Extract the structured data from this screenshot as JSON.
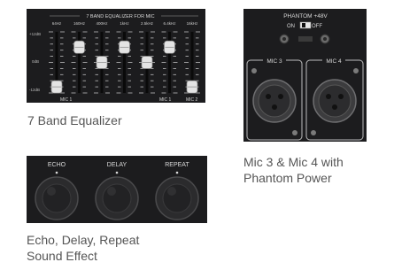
{
  "equalizer": {
    "title": "7 BAND EQUALIZER FOR MIC",
    "freqs": [
      "64Hz",
      "160Hz",
      "400Hz",
      "1kHz",
      "2.5kHz",
      "6.4kHz",
      "16kHz"
    ],
    "scale": {
      "top": "+12dB",
      "mid": "0dB",
      "bottom": "-12dB"
    },
    "bottom_labels": [
      "MIC 1",
      "MIC 2"
    ],
    "bottom_labels_right": [
      "MIC 1",
      "MIC 2"
    ],
    "slider_levels": [
      0.1,
      0.75,
      0.5,
      0.75,
      0.5,
      0.75,
      0.1
    ],
    "caption": "7 Band Equalizer"
  },
  "phantom": {
    "title": "PHANTOM +48V",
    "on_label": "ON",
    "off_label": "OFF",
    "mic3_label": "MIC 3",
    "mic4_label": "MIC 4",
    "caption_line1": "Mic 3 & Mic 4 with",
    "caption_line2": "Phantom Power"
  },
  "effects": {
    "knobs": [
      "ECHO",
      "DELAY",
      "REPEAT"
    ],
    "caption_line1": "Echo, Delay, Repeat",
    "caption_line2": "Sound Effect"
  },
  "colors": {
    "panel": "#1c1c1e",
    "caption": "#555555",
    "label": "#d9d9d9",
    "knob": "#2b2b2d"
  }
}
